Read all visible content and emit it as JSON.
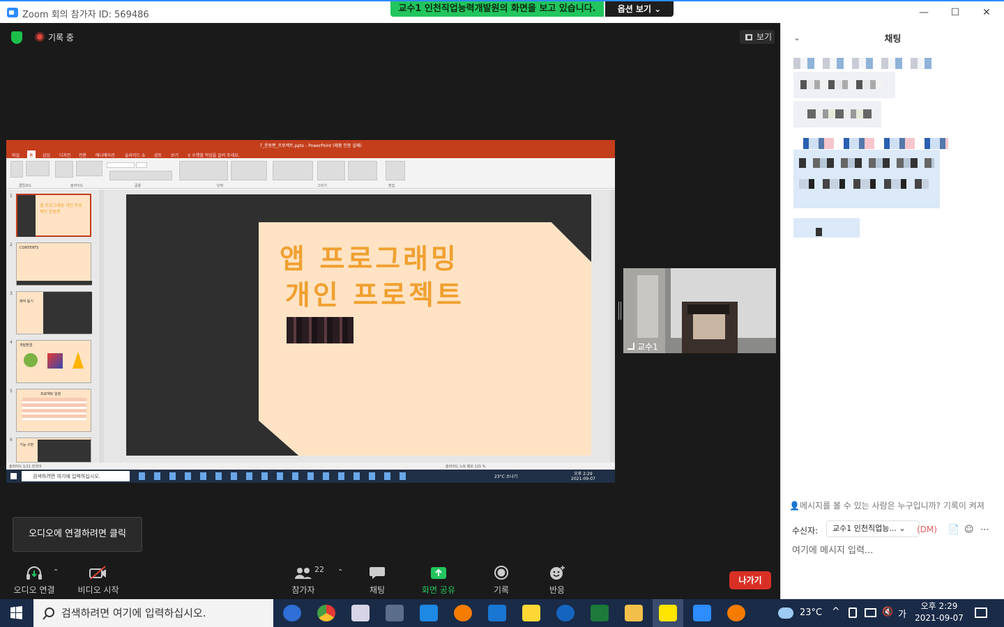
{
  "window": {
    "title": "Zoom 회의 참가자 ID: 569486",
    "minimize": "—",
    "maximize": "☐",
    "close": "✕"
  },
  "share_banner": {
    "text": "교수1 인천직업능력개발원의 화면을 보고 있습니다.",
    "options_label": "옵션 보기 ⌄"
  },
  "meeting": {
    "recording_label": "기록 중",
    "view_label": "보기"
  },
  "shared_screen": {
    "ppt_title": "7_운동편_프로젝트.pptx - PowerPoint (제품 인증 실패)",
    "ppt_menu": [
      "파일",
      "홈",
      "삽입",
      "디자인",
      "전환",
      "애니메이션",
      "슬라이드 쇼",
      "검토",
      "보기",
      "♀ 수행할 작업을 알려 주세요."
    ],
    "ribbon_groups": [
      "클립보드",
      "슬라이드",
      "글꼴",
      "단락",
      "그리기",
      "편집"
    ],
    "slide_thumbs": [
      {
        "num": "1",
        "text": "앱 프로그래밍 개인 프로젝트 운동편"
      },
      {
        "num": "2",
        "text": "CONTENTS"
      },
      {
        "num": "3",
        "text": "제작 동기"
      },
      {
        "num": "4",
        "text": "개발환경"
      },
      {
        "num": "5",
        "text": "프로젝트 일정"
      },
      {
        "num": "6",
        "text": "기능 구현"
      }
    ],
    "slide_title_line1": "앱  프로그래밍",
    "slide_title_line2": "개인  프로젝트",
    "status_left": "슬라이드 1/11   한국어",
    "status_right": "슬라이드 노트   메모   115 %",
    "inner_search": "검색하려면 여기에 입력하십시오.",
    "inner_weather": "23°C 소나기",
    "inner_time": "오후 2:29",
    "inner_date": "2021-09-07"
  },
  "video": {
    "participant_name": "교수1"
  },
  "audio_tooltip": "오디오에 연결하려면 클릭",
  "toolbar": {
    "audio": "오디오 연결",
    "video": "비디오 시작",
    "participants": "참가자",
    "participants_count": "22",
    "chat": "채팅",
    "share": "화면 공유",
    "record": "기록",
    "reactions": "반응",
    "leave": "나가기"
  },
  "chat": {
    "title": "채팅",
    "info_text": "메시지를 볼 수 있는 사람은 누구입니까? 기록이 켜져",
    "recipient_label": "수신자:",
    "recipient_value": "교수1 인천직업능...",
    "dm_label": "(DM)",
    "input_placeholder": "여기에 메시지 입력..."
  },
  "taskbar": {
    "search_placeholder": "검색하려면 여기에 입력하십시오.",
    "weather": "23°C",
    "lang": "가",
    "time": "오후 2:29",
    "date": "2021-09-07"
  },
  "colors": {
    "zoom_blue": "#2d8cff",
    "share_green": "#22c55e",
    "leave_red": "#d93025",
    "ppt_red": "#c43e1c",
    "slide_orange": "#f0a030"
  }
}
